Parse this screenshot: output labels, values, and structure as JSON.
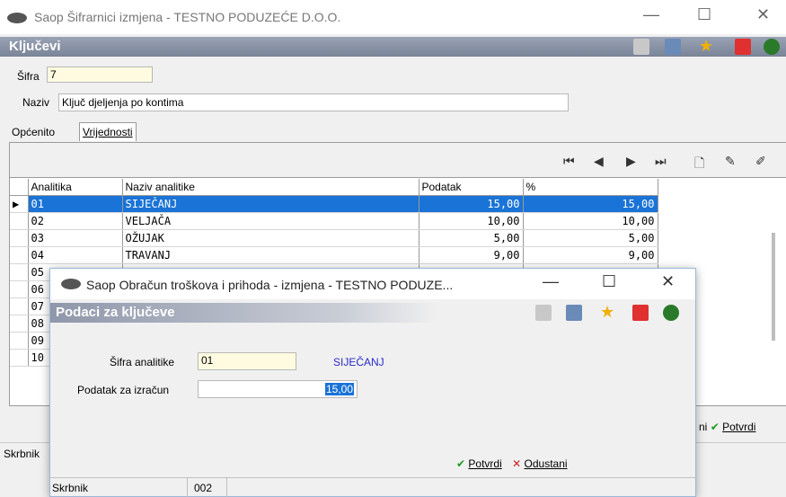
{
  "main": {
    "title": "Saop Šifrarnici izmjena  - TESTNO PODUZEĆE D.O.O.",
    "section_title": "Ključevi",
    "sifra_label": "Šifra",
    "sifra_value": "7",
    "naziv_label": "Naziv",
    "naziv_value": "Ključ djeljenja po kontima",
    "tabs": [
      {
        "label": "Općenito"
      },
      {
        "label": "Vrijednosti"
      }
    ],
    "grid": {
      "columns": [
        "Analitika",
        "Naziv analitike",
        "Podatak",
        "%"
      ],
      "rows": [
        {
          "analitika": "01",
          "naziv": "SIJEČANJ",
          "podatak": "15,00",
          "pct": "15,00"
        },
        {
          "analitika": "02",
          "naziv": "VELJAČA",
          "podatak": "10,00",
          "pct": "10,00"
        },
        {
          "analitika": "03",
          "naziv": "OŽUJAK",
          "podatak": "5,00",
          "pct": "5,00"
        },
        {
          "analitika": "04",
          "naziv": "TRAVANJ",
          "podatak": "9,00",
          "pct": "9,00"
        },
        {
          "analitika": "05"
        },
        {
          "analitika": "06"
        },
        {
          "analitika": "07"
        },
        {
          "analitika": "08"
        },
        {
          "analitika": "09"
        },
        {
          "analitika": "10"
        }
      ]
    },
    "bottom_buttons": {
      "odustani_partial": "ni",
      "potvrdi": "Potvrdi"
    },
    "status_label": "Skrbnik"
  },
  "dialog": {
    "title": "Saop Obračun troškova i prihoda - izmjena  - TESTNO PODUZE...",
    "section_title": "Podaci za ključeve",
    "sifra_analitike_label": "Šifra analitike",
    "sifra_analitike_value": "01",
    "sifra_analitike_name": "SIJEČANJ",
    "podatak_label": "Podatak za izračun",
    "podatak_value": "15,00",
    "potvrdi": "Potvrdi",
    "odustani": "Odustani",
    "status_label": "Skrbnik",
    "status_value": "002"
  },
  "colors": {
    "accent": "#1a73d6",
    "field_yellow": "#fffbe0",
    "link_blue": "#2a2ac8"
  }
}
